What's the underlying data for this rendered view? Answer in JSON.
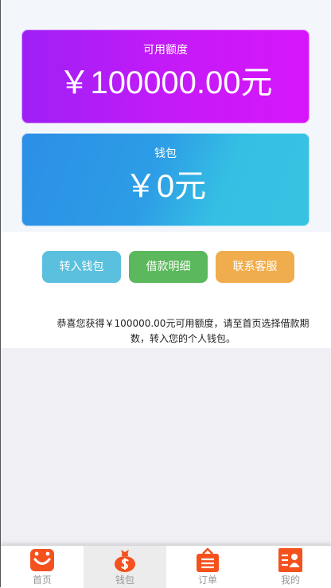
{
  "cards": {
    "limit": {
      "label": "可用额度",
      "amount": "￥100000.00元"
    },
    "wallet": {
      "label": "钱包",
      "amount": "￥0元"
    }
  },
  "actions": {
    "transfer_label": "转入钱包",
    "detail_label": "借款明细",
    "service_label": "联系客服"
  },
  "notice": "恭喜您获得￥100000.00元可用额度，请至首页选择借款期数，转入您的个人钱包。",
  "tabs": [
    {
      "label": "首页",
      "icon": "home-icon"
    },
    {
      "label": "钱包",
      "icon": "wallet-icon"
    },
    {
      "label": "订单",
      "icon": "orders-icon"
    },
    {
      "label": "我的",
      "icon": "profile-icon"
    }
  ],
  "active_tab": "钱包",
  "colors": {
    "tab_icon": "#f4511e",
    "transfer_button": "#5bc0de",
    "detail_button": "#5cb85c",
    "service_button": "#f0ad4e"
  }
}
